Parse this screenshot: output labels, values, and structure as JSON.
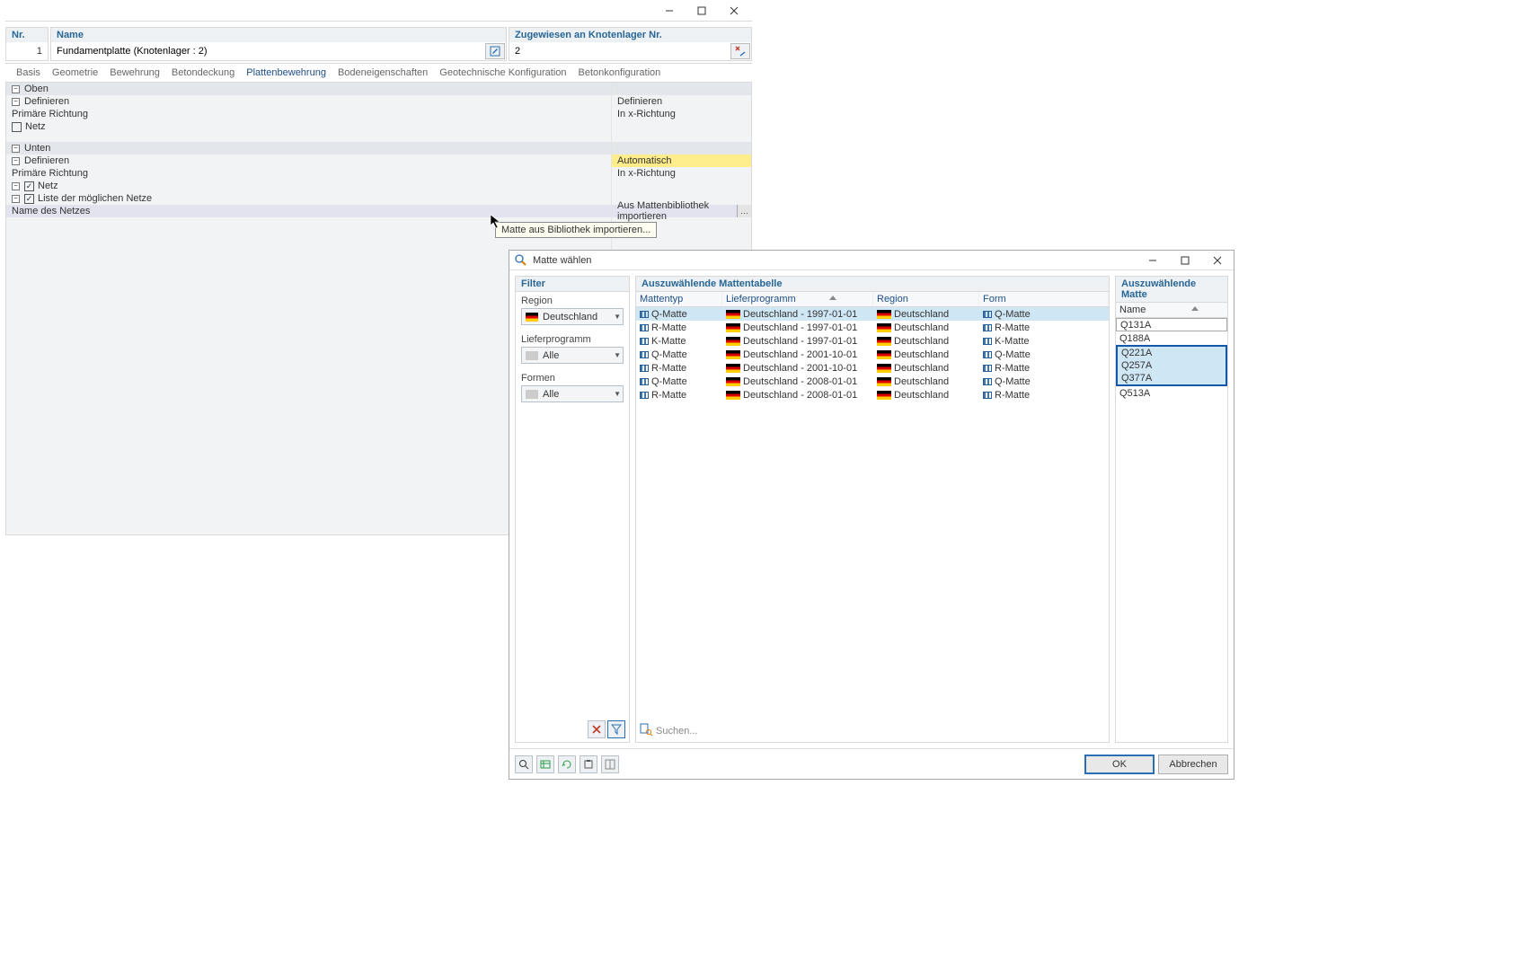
{
  "window1": {
    "nr_label": "Nr.",
    "nr_value": "1",
    "name_label": "Name",
    "name_value": "Fundamentplatte (Knotenlager : 2)",
    "assigned_label": "Zugewiesen an Knotenlager Nr.",
    "assigned_value": "2"
  },
  "tabs": [
    "Basis",
    "Geometrie",
    "Bewehrung",
    "Betondeckung",
    "Plattenbewehrung",
    "Bodeneigenschaften",
    "Geotechnische Konfiguration",
    "Betonkonfiguration"
  ],
  "active_tab": 4,
  "tree": {
    "oben": "Oben",
    "unten": "Unten",
    "definieren": "Definieren",
    "prim": "Primäre Richtung",
    "netz": "Netz",
    "liste": "Liste der möglichen Netze",
    "namedes": "Name des Netzes",
    "r_definieren": "Definieren",
    "r_inx": "In x-Richtung",
    "r_auto": "Automatisch",
    "r_import": "Aus Mattenbibliothek importieren",
    "r_dots": "…"
  },
  "tooltip": "Matte aus Bibliothek importieren...",
  "dialog": {
    "title": "Matte wählen",
    "filter_hdr": "Filter",
    "table_hdr": "Auszuwählende Mattentabelle",
    "names_hdr": "Auszuwählende Matte",
    "lbl_region": "Region",
    "lbl_liefer": "Lieferprogramm",
    "lbl_formen": "Formen",
    "val_region": "Deutschland",
    "val_alle": "Alle",
    "th": {
      "mt": "Mattentyp",
      "lp": "Lieferprogramm",
      "rg": "Region",
      "fm": "Form",
      "nm": "Name"
    },
    "rows": [
      {
        "mt": "Q-Matte",
        "lp": "Deutschland - 1997-01-01",
        "rg": "Deutschland",
        "fm": "Q-Matte"
      },
      {
        "mt": "R-Matte",
        "lp": "Deutschland - 1997-01-01",
        "rg": "Deutschland",
        "fm": "R-Matte"
      },
      {
        "mt": "K-Matte",
        "lp": "Deutschland - 1997-01-01",
        "rg": "Deutschland",
        "fm": "K-Matte"
      },
      {
        "mt": "Q-Matte",
        "lp": "Deutschland - 2001-10-01",
        "rg": "Deutschland",
        "fm": "Q-Matte"
      },
      {
        "mt": "R-Matte",
        "lp": "Deutschland - 2001-10-01",
        "rg": "Deutschland",
        "fm": "R-Matte"
      },
      {
        "mt": "Q-Matte",
        "lp": "Deutschland - 2008-01-01",
        "rg": "Deutschland",
        "fm": "Q-Matte"
      },
      {
        "mt": "R-Matte",
        "lp": "Deutschland - 2008-01-01",
        "rg": "Deutschland",
        "fm": "R-Matte"
      }
    ],
    "names": [
      "Q131A",
      "Q188A",
      "Q221A",
      "Q257A",
      "Q377A",
      "Q513A"
    ],
    "search_placeholder": "Suchen...",
    "ok": "OK",
    "cancel": "Abbrechen"
  }
}
